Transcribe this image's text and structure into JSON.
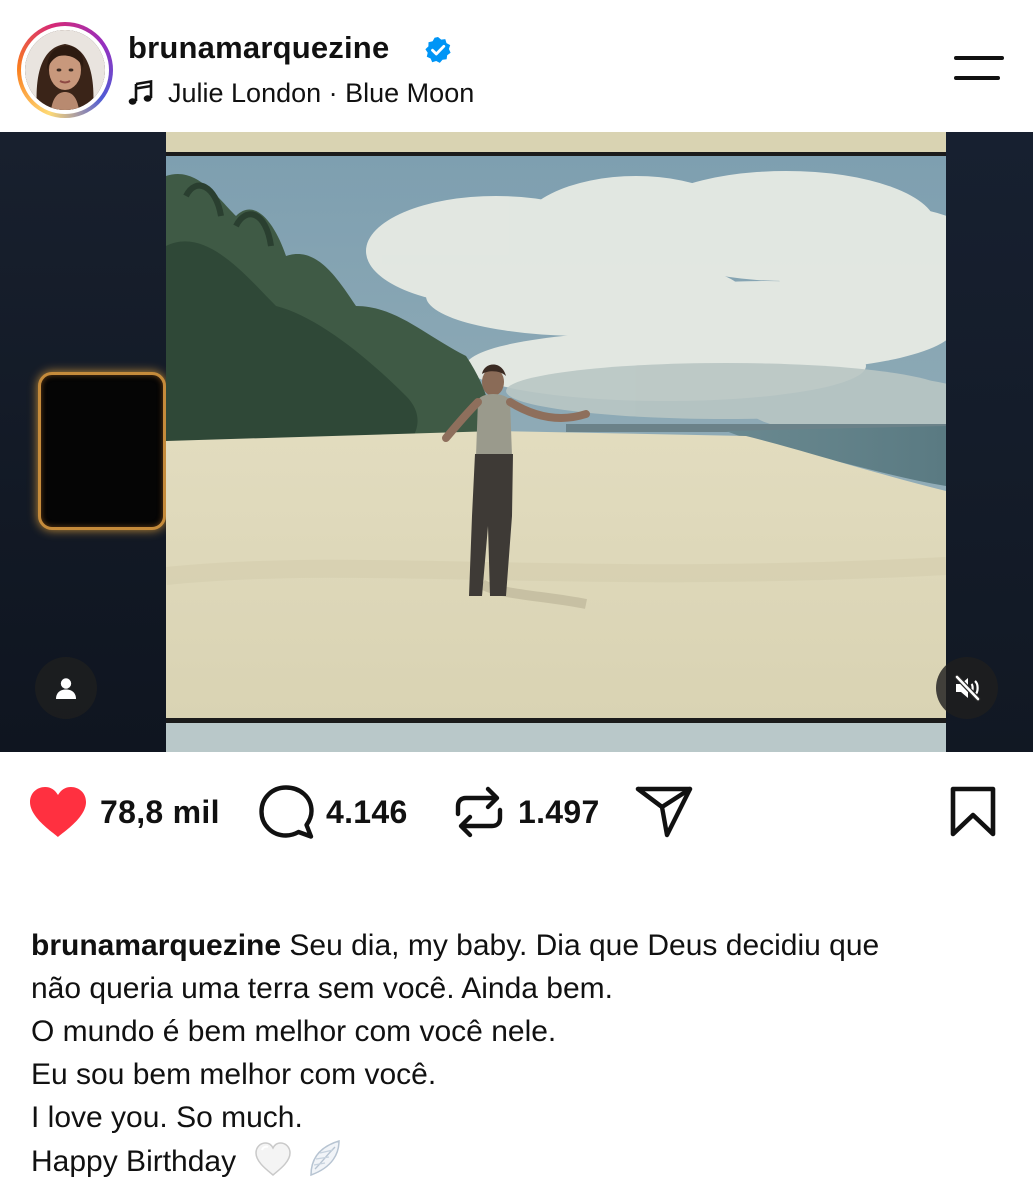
{
  "header": {
    "username": "brunamarquezine",
    "music_artist": "Julie London",
    "music_separator": " · ",
    "music_track": "Blue Moon",
    "verified_icon": "verified-badge-icon",
    "music_icon": "music-note-icon",
    "menu_icon": "menu-icon"
  },
  "media": {
    "tag_icon": "person-tag-icon",
    "mute_icon": "speaker-muted-icon"
  },
  "actions": {
    "likes": "78,8 mil",
    "comments": "4.146",
    "reposts": "1.497",
    "like_icon": "heart-filled-icon",
    "comment_icon": "comment-bubble-icon",
    "repost_icon": "repost-icon",
    "share_icon": "paper-plane-icon",
    "save_icon": "bookmark-icon"
  },
  "caption": {
    "username": "brunamarquezine",
    "lines": [
      "Seu dia, my baby. Dia que Deus decidiu que",
      "não queria uma terra sem você. Ainda bem.",
      "O mundo é bem melhor com você nele.",
      "Eu sou bem melhor com você.",
      "I love you. So much.",
      "Happy Birthday"
    ],
    "emojis": [
      "white-heart",
      "wing"
    ]
  },
  "colors": {
    "like_red": "#ff3040",
    "verified_blue": "#0095f6",
    "text": "#111111"
  }
}
